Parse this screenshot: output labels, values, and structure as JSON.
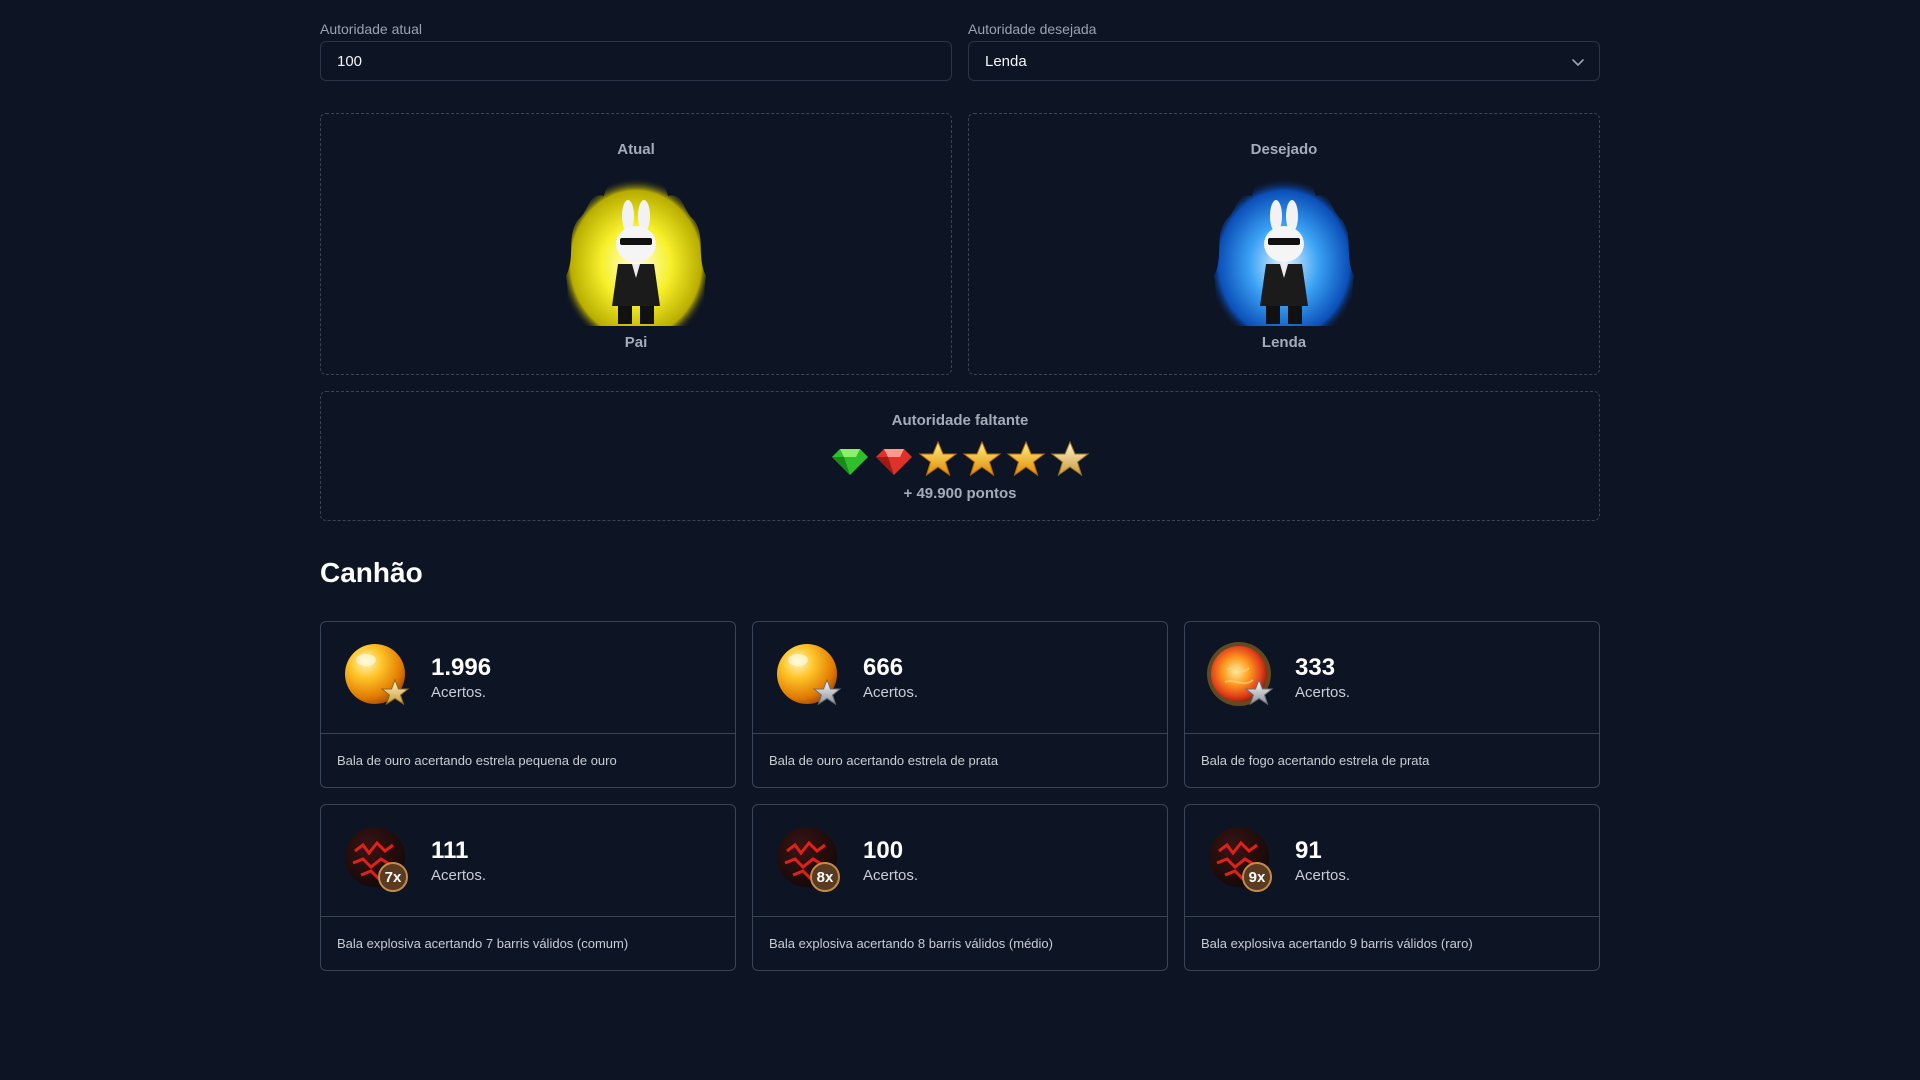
{
  "inputs": {
    "current_label": "Autoridade atual",
    "current_value": "100",
    "desired_label": "Autoridade desejada",
    "desired_value": "Lenda"
  },
  "panels": {
    "current": {
      "title": "Atual",
      "rank_name": "Pai",
      "aura_color": "#f5e90a"
    },
    "desired": {
      "title": "Desejado",
      "rank_name": "Lenda",
      "aura_color": "#2f8cf0"
    }
  },
  "missing": {
    "title": "Autoridade faltante",
    "rank_icons": [
      "green-gem-icon",
      "red-gem-icon",
      "gold-star-icon",
      "gold-star-icon",
      "gold-star-icon",
      "silver-gold-star-icon"
    ],
    "points": "+ 49.900 pontos"
  },
  "section": {
    "title": "Canhão"
  },
  "cards": [
    {
      "value": "1.996",
      "unit": "Acertos.",
      "desc": "Bala de ouro acertando estrela pequena de ouro",
      "icon": "gold-bullet-gold-star-icon"
    },
    {
      "value": "666",
      "unit": "Acertos.",
      "desc": "Bala de ouro acertando estrela de prata",
      "icon": "gold-bullet-silver-star-icon"
    },
    {
      "value": "333",
      "unit": "Acertos.",
      "desc": "Bala de fogo acertando estrela de prata",
      "icon": "fire-bullet-silver-star-icon"
    },
    {
      "value": "111",
      "unit": "Acertos.",
      "desc": "Bala explosiva acertando 7 barris válidos (comum)",
      "icon": "explosive-bullet-icon",
      "badge": "7x"
    },
    {
      "value": "100",
      "unit": "Acertos.",
      "desc": "Bala explosiva acertando 8 barris válidos (médio)",
      "icon": "explosive-bullet-icon",
      "badge": "8x"
    },
    {
      "value": "91",
      "unit": "Acertos.",
      "desc": "Bala explosiva acertando 9 barris válidos (raro)",
      "icon": "explosive-bullet-icon",
      "badge": "9x"
    }
  ]
}
